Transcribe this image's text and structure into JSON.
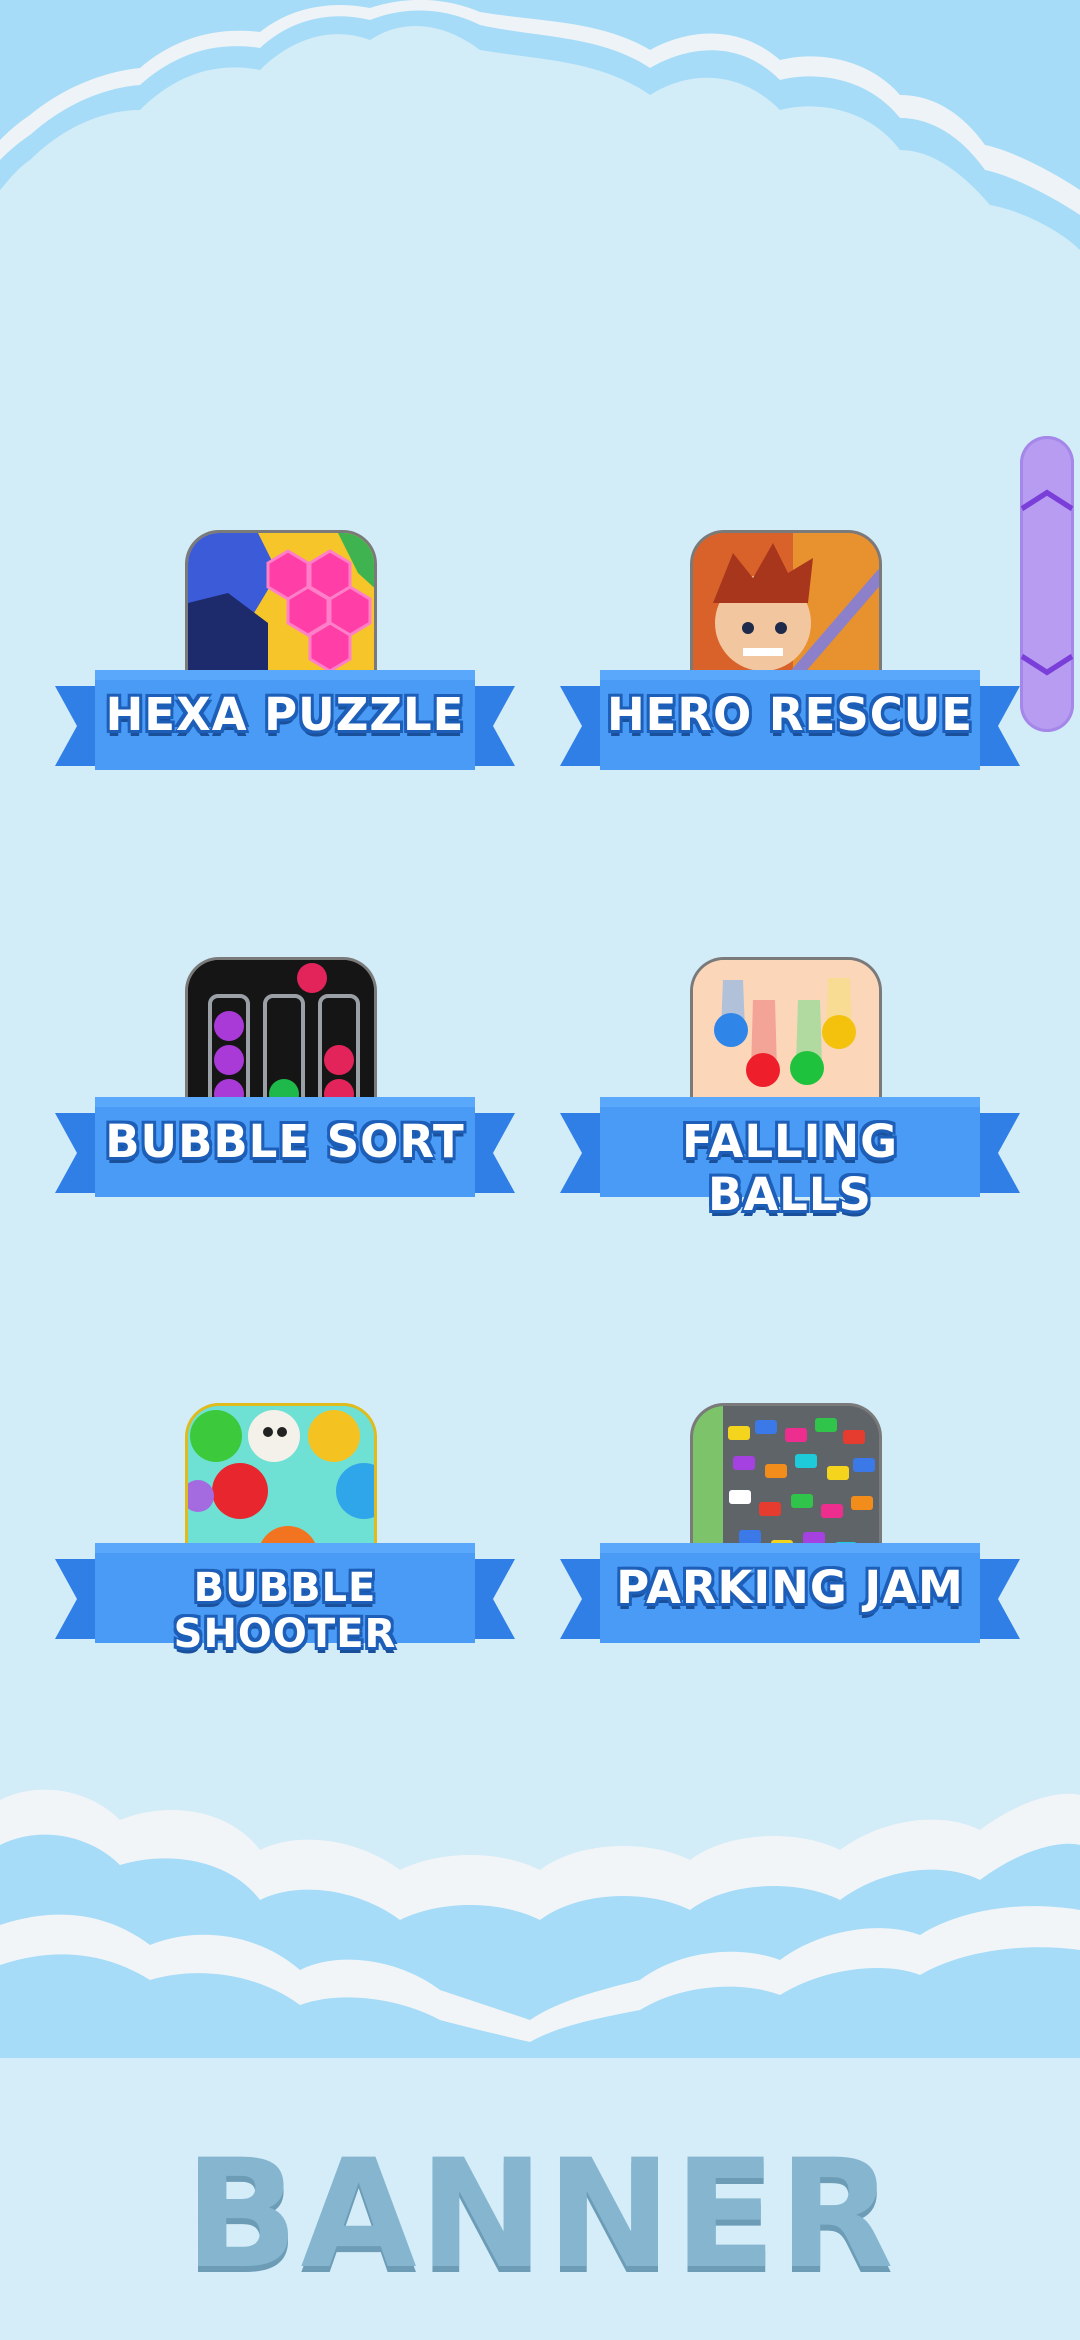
{
  "games": [
    {
      "name": "HEXA PUZZLE"
    },
    {
      "name": "HERO RESCUE"
    },
    {
      "name": "BUBBLE SORT"
    },
    {
      "name": "FALLING BALLS"
    },
    {
      "name": "BUBBLE SHOOTER"
    },
    {
      "name": "PARKING JAM"
    }
  ],
  "banner": {
    "text": "BANNER"
  },
  "scroll": {
    "up_icon": "chevron-up-icon",
    "down_icon": "chevron-down-icon"
  },
  "colors": {
    "background": "#d2ecf8",
    "ribbon": "#3f8ef0",
    "scroll_pill": "#b79cf2"
  }
}
